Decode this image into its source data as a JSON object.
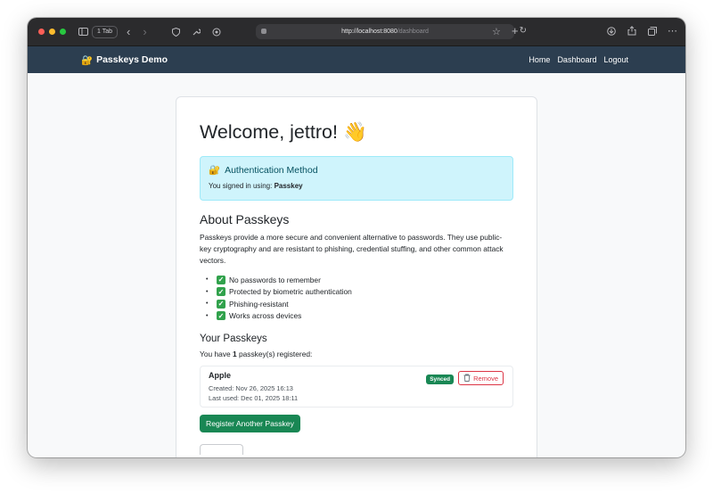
{
  "browser": {
    "tab_count": "1 Tab",
    "url_host": "http://localhost:8080",
    "url_path": "/dashboard"
  },
  "navbar": {
    "brand": "Passkeys Demo",
    "brand_icon": "🔐",
    "links": [
      "Home",
      "Dashboard",
      "Logout"
    ]
  },
  "welcome": {
    "title": "Welcome, jettro!",
    "emoji": "👋"
  },
  "auth_alert": {
    "icon": "🔐",
    "title": "Authentication Method",
    "body_prefix": "You signed in using:",
    "method": "Passkey"
  },
  "about": {
    "heading": "About Passkeys",
    "paragraph": "Passkeys provide a more secure and convenient alternative to passwords. They use public-key cryptography and are resistant to phishing, credential stuffing, and other common attack vectors.",
    "features": [
      "No passwords to remember",
      "Protected by biometric authentication",
      "Phishing-resistant",
      "Works across devices"
    ]
  },
  "passkeys": {
    "heading": "Your Passkeys",
    "count_prefix": "You have",
    "count": "1",
    "count_suffix": "passkey(s) registered:",
    "items": [
      {
        "name": "Apple",
        "created": "Created: Nov 26, 2025 16:13",
        "last_used": "Last used: Dec 01, 2025 18:11",
        "badge": "Synced",
        "remove_label": "Remove"
      }
    ],
    "register_label": "Register Another Passkey"
  },
  "colors": {
    "navbar_bg": "#2c3e50",
    "alert_bg": "#cff4fc",
    "success": "#198754",
    "danger": "#dc3545"
  }
}
